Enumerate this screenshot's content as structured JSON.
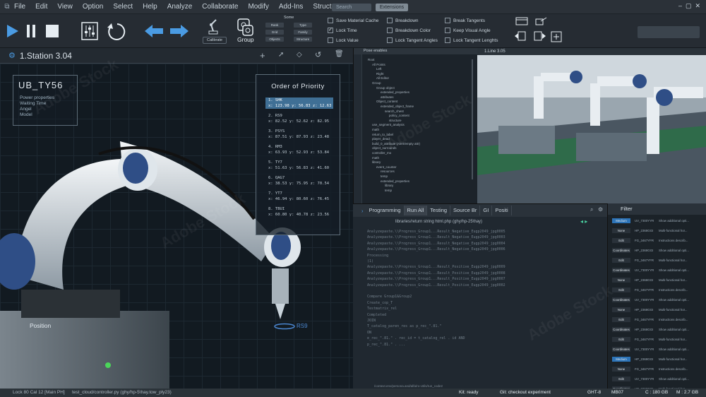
{
  "menu": {
    "items": [
      "File",
      "Edit",
      "View",
      "Option",
      "Select",
      "Help",
      "Analyze",
      "Collaborate",
      "Modify",
      "Add-Ins",
      "Structure"
    ],
    "search": "Search",
    "extensions": "Extensions"
  },
  "toolbar": {
    "calibrate": "Calibrate",
    "group": "Group",
    "some_label": "Some",
    "some_buttons": [
      "Rank",
      "Type",
      "Grid",
      "Family",
      "Objects",
      "Structure"
    ],
    "checkboxes": [
      {
        "label": "Save Material Cache",
        "checked": false
      },
      {
        "label": "Breakdown",
        "checked": false
      },
      {
        "label": "Break Tangents",
        "checked": false
      },
      {
        "label": "Lock Time",
        "checked": true
      },
      {
        "label": "Breakdown Color",
        "checked": false
      },
      {
        "label": "Keep Visual Angle",
        "checked": false
      },
      {
        "label": "Lock Value",
        "checked": false
      },
      {
        "label": "Lock Tangent Angles",
        "checked": false
      },
      {
        "label": "Lock Tangent Lenghts",
        "checked": false
      }
    ]
  },
  "viewport": {
    "title": "1.Station 3.04",
    "ub_title": "UB_TY56",
    "ub_lines": [
      "Power properties",
      "Waiting Time",
      "Angel",
      "Model"
    ],
    "priority_title": "Order of Priority",
    "priority": [
      {
        "name": "1. SHK",
        "coords": "x: 123.98 y: 56.83 z: 12.63"
      },
      {
        "name": "2. RS9",
        "coords": "x: 82.52 y: 52.62 z: 82.95"
      },
      {
        "name": "3. PSYS",
        "coords": "x: 87.51 y: 87.93 z: 23.48"
      },
      {
        "name": "4. RM3",
        "coords": "x: 63.93 y: 52.93 z: 53.84"
      },
      {
        "name": "5. TY7",
        "coords": "x: 51.63 y: 56.83 z: 41.60"
      },
      {
        "name": "6. QAG7",
        "coords": "x: 38.53 y: 75.95 z: 70.54"
      },
      {
        "name": "7. YT7",
        "coords": "x: 46.94 y: 80.60 z: 76.45"
      },
      {
        "name": "8. TBUI",
        "coords": "x: 60.80 y: 40.78 z: 23.56"
      }
    ],
    "position_label": "Position",
    "target_label": "RS9"
  },
  "tree": {
    "title": "Pose enables",
    "rows": [
      "Root",
      "All Points",
      "Left",
      "Right",
      "All Editor",
      "Group",
      "Group object",
      "extended_properties",
      "attributes",
      "Object_content",
      "extended_object_frame",
      "search_chest",
      "policy_content",
      "structure",
      "use_segment_analysis",
      "math",
      "return_to_label",
      "player_dead",
      "build_0_attribute (Alert/empty attr)",
      "object_surrounds",
      "controller_mo",
      "math",
      "library",
      "event_counter",
      "resources",
      "temp",
      "extended_properties",
      "library",
      "temp"
    ]
  },
  "camera": {
    "title": "1.Line 3.05"
  },
  "programming": {
    "tabs": [
      "Programming",
      "Run All",
      "Testing",
      "Source Br",
      "GI",
      "Positi"
    ],
    "path": "libraries/return string html.php (ghy/hp-25\\hay)",
    "code": [
      "Analyzepaste.\\\\Progress_Group1...Result_Negative_Eugp2049_jpg0005",
      "Analyzepaste.\\\\Progress_Group1...Result_Negative_Eugp2049_jpg0003",
      "Analyzepaste.\\\\Progress_Group1...Result_Negative_Eugp2049_jpg0004",
      "Analyzepaste.\\\\Progress_Group1...Result_Negative_Eugp2049_jpg0006",
      "Processing",
      "(1)",
      "Analyzepaste.\\\\Progress_Group1...Result_Positive_Eugp2049_jpg0009",
      "Analyzepaste.\\\\Progress_Group1...Result_Positive_Eugp2049_jpg0008",
      "Analyzepaste.\\\\Progress_Group1...Result_Positive_Eugp2049_jpg0007",
      "Analyzepaste.\\\\Progress_Group1...Result_Positive_Eugp2049_jpg0002",
      "",
      "Compare Group1&Group2",
      "Create_cop_T",
      "Testmatrix_rel",
      "Completed",
      "JOIN",
      "    T_catalog_paren_res as  p_rec_\".81.\"",
      "         ON",
      "      e_rec_\".81.\" . rec_id  = t_catalog_rel . id  AND",
      "      p_rec_\".81.\" . ..."
    ],
    "footer": "/context.env/persona.and/alfa/ro-Utils/run_code2"
  },
  "filter": {
    "title": "Filter",
    "rows": [
      {
        "btn": "Medium",
        "c2": "UV_7300YYR",
        "c3": "Show additional opti...",
        "hl": true
      },
      {
        "btn": "None",
        "c2": "HP_2368GGI",
        "c3": "Multi-functional hor...",
        "hl": false
      },
      {
        "btn": "Edit",
        "c2": "FG_3467YFR",
        "c3": "Instructions describ...",
        "hl": false
      },
      {
        "btn": "Coordinates",
        "c2": "HP_2368GGI",
        "c3": "Show additional opti...",
        "hl": false
      },
      {
        "btn": "Edit",
        "c2": "FG_3467YFR",
        "c3": "Multi-functional hor...",
        "hl": false
      },
      {
        "btn": "Coordinates",
        "c2": "UV_7300YYR",
        "c3": "Show additional opti...",
        "hl": false
      },
      {
        "btn": "None",
        "c2": "HP_2368GGI",
        "c3": "Multi-functional hor...",
        "hl": false
      },
      {
        "btn": "Edit",
        "c2": "FG_3467YFR",
        "c3": "Instructions describ...",
        "hl": false
      },
      {
        "btn": "Coordinates",
        "c2": "UV_7300YYR",
        "c3": "Show additional opti...",
        "hl": false
      },
      {
        "btn": "None",
        "c2": "HP_2368GGI",
        "c3": "Multi-functional hor...",
        "hl": false
      },
      {
        "btn": "Edit",
        "c2": "FG_3467YFR",
        "c3": "Instructions describ...",
        "hl": false
      },
      {
        "btn": "Coordinates",
        "c2": "HP_2368GGI",
        "c3": "Show additional opti...",
        "hl": false
      },
      {
        "btn": "Edit",
        "c2": "FG_3467YFR",
        "c3": "Multi-functional hor...",
        "hl": false
      },
      {
        "btn": "Coordinates",
        "c2": "UV_7300YYR",
        "c3": "Show additional opti...",
        "hl": false
      },
      {
        "btn": "Medium",
        "c2": "HP_2368GGI",
        "c3": "Multi-functional hor...",
        "hl": true
      },
      {
        "btn": "None",
        "c2": "FG_3467YFR",
        "c3": "Instructions describ...",
        "hl": false
      },
      {
        "btn": "Edit",
        "c2": "UV_7300YYR",
        "c3": "Show additional opti...",
        "hl": false
      },
      {
        "btn": "Coordinates",
        "c2": "HP_2368GGI",
        "c3": "Multi-functional hor...",
        "hl": false
      }
    ]
  },
  "status": {
    "left": "Lock 80 Cal 12 [Main PH]",
    "file": "test_cloud/controller.py (ghy/hp-5\\hay.tow_ply23)",
    "kit": "Kit: ready",
    "git": "Git: checkout experiment",
    "ght": "GHT-8",
    "mb": "MB07",
    "c": "C : 180 GB",
    "m": "M : 2.7 GB"
  },
  "watermark": {
    "brand": "Adobe Stock",
    "id": "#464408193"
  },
  "colors": {
    "accent": "#3f6f95",
    "toolbar_blue": "#4a9be3",
    "status_btn": "#2d74b8"
  }
}
